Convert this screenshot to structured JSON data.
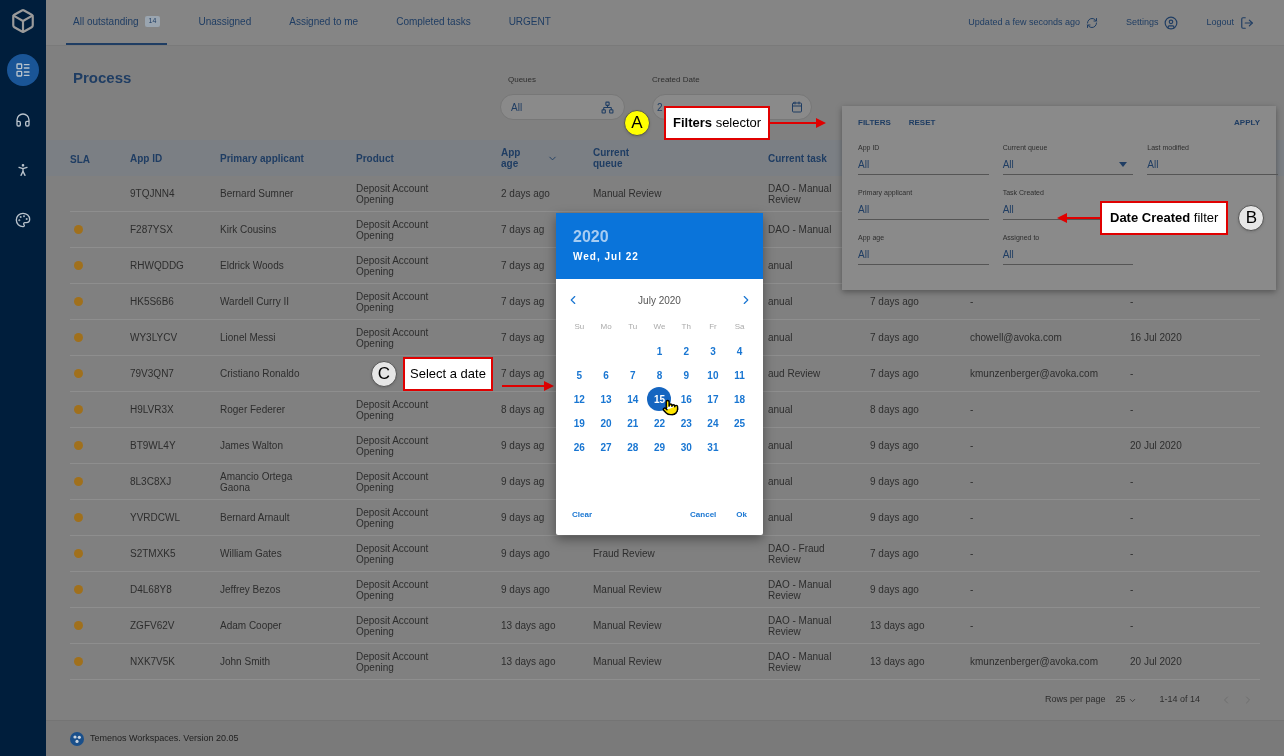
{
  "sidebar": {
    "items": [
      {
        "kind": "dashboard",
        "selected": true
      },
      {
        "kind": "support",
        "selected": false
      },
      {
        "kind": "accessibility",
        "selected": false
      },
      {
        "kind": "palette",
        "selected": false
      }
    ]
  },
  "tabs": [
    {
      "label": "All outstanding",
      "badge": "14",
      "selected": true
    },
    {
      "label": "Unassigned",
      "selected": false
    },
    {
      "label": "Assigned to me",
      "selected": false
    },
    {
      "label": "Completed tasks",
      "selected": false
    },
    {
      "label": "URGENT",
      "selected": false
    }
  ],
  "header_right": {
    "status": "Updated a few seconds ago",
    "settings": "Settings",
    "logout": "Logout"
  },
  "page_title": "Process",
  "filter_bar": {
    "queues": {
      "label": "Queues",
      "value": "All"
    },
    "created_date": {
      "label": "Created Date",
      "value": "2"
    }
  },
  "table": {
    "sla_header": "SLA",
    "columns": [
      {
        "label": "App ID",
        "sorted": false
      },
      {
        "label": "Primary applicant",
        "sorted": false
      },
      {
        "label": "Product",
        "sorted": false
      },
      {
        "label": "App age",
        "sorted": true
      },
      {
        "label": "Current queue",
        "sorted": false
      },
      {
        "label": "Current task",
        "sorted": false
      }
    ],
    "rows": [
      {
        "sla_dot": false,
        "cells": [
          "9TQJNN4",
          "Bernard Sumner",
          "Deposit Account Opening",
          "2 days ago",
          "Manual Review",
          "DAO - Manual Review",
          null,
          null,
          null
        ]
      },
      {
        "sla_dot": true,
        "cells": [
          "F287YSX",
          "Kirk Cousins",
          "Deposit Account Opening",
          "7 days ag",
          null,
          "DAO - Manual",
          null,
          null,
          null
        ]
      },
      {
        "sla_dot": true,
        "cells": [
          "RHWQDDG",
          "Eldrick Woods",
          "Deposit Account Opening",
          "7 days ag",
          null,
          "anual",
          null,
          null,
          null
        ]
      },
      {
        "sla_dot": true,
        "cells": [
          "HK5S6B6",
          "Wardell Curry II",
          "Deposit Account Opening",
          "7 days ag",
          null,
          "anual",
          "7 days ago",
          "-",
          "-"
        ]
      },
      {
        "sla_dot": true,
        "cells": [
          "WY3LYCV",
          "Lionel Messi",
          "Deposit Account Opening",
          "7 days ag",
          null,
          "anual",
          "7 days ago",
          "chowell@avoka.com",
          "16 Jul 2020"
        ]
      },
      {
        "sla_dot": true,
        "cells": [
          "79V3QN7",
          "Cristiano Ronaldo",
          null,
          "7 days ag",
          null,
          "aud Review",
          "7 days ago",
          "kmunzenberger@avoka.com",
          "-"
        ]
      },
      {
        "sla_dot": true,
        "cells": [
          "H9LVR3X",
          "Roger Federer",
          "Deposit Account Opening",
          "8 days ag",
          null,
          "anual",
          "8 days ago",
          "-",
          "-"
        ]
      },
      {
        "sla_dot": true,
        "cells": [
          "BT9WL4Y",
          "James Walton",
          "Deposit Account Opening",
          "9 days ag",
          null,
          "anual",
          "9 days ago",
          "-",
          "20 Jul 2020"
        ]
      },
      {
        "sla_dot": true,
        "cells": [
          "8L3C8XJ",
          "Amancio Ortega Gaona",
          "Deposit Account Opening",
          "9 days ag",
          null,
          "anual",
          "9 days ago",
          "-",
          "-"
        ]
      },
      {
        "sla_dot": true,
        "cells": [
          "YVRDCWL",
          "Bernard Arnault",
          "Deposit Account Opening",
          "9 days ag",
          null,
          "anual",
          "9 days ago",
          "-",
          "-"
        ]
      },
      {
        "sla_dot": true,
        "cells": [
          "S2TMXK5",
          "William Gates",
          "Deposit Account Opening",
          "9 days ago",
          "Fraud Review",
          "DAO - Fraud Review",
          "7 days ago",
          "-",
          "-"
        ]
      },
      {
        "sla_dot": true,
        "cells": [
          "D4L68Y8",
          "Jeffrey Bezos",
          "Deposit Account Opening",
          "9 days ago",
          "Manual Review",
          "DAO - Manual Review",
          "9 days ago",
          "-",
          "-"
        ]
      },
      {
        "sla_dot": true,
        "cells": [
          "ZGFV62V",
          "Adam Cooper",
          "Deposit Account Opening",
          "13 days ago",
          "Manual Review",
          "DAO - Manual Review",
          "13 days ago",
          "-",
          "-"
        ]
      },
      {
        "sla_dot": true,
        "cells": [
          "NXK7V5K",
          "John Smith",
          "Deposit Account Opening",
          "13 days ago",
          "Manual Review",
          "DAO - Manual Review",
          "13 days ago",
          "kmunzenberger@avoka.com",
          "20 Jul 2020"
        ]
      }
    ]
  },
  "filters_panel": {
    "actions": [
      "FILTERS",
      "RESET"
    ],
    "apply": "APPLY",
    "field_rows": [
      [
        {
          "label": "App ID",
          "value": "All",
          "kind": "text"
        },
        {
          "label": "Current queue",
          "value": "All",
          "kind": "select"
        },
        {
          "label": "Last modified",
          "value": "All",
          "kind": "text"
        }
      ],
      [
        {
          "label": "Primary applicant",
          "value": "All",
          "kind": "text"
        },
        {
          "label": "Task Created",
          "value": "All",
          "kind": "text"
        }
      ],
      [
        {
          "label": "App age",
          "value": "All",
          "kind": "text"
        },
        {
          "label": "Assigned to",
          "value": "All",
          "kind": "text"
        }
      ]
    ]
  },
  "date_picker": {
    "year": "2020",
    "date": "Wed, Jul 22",
    "month": "July 2020",
    "weekdays": [
      "Su",
      "Mo",
      "Tu",
      "We",
      "Th",
      "Fr",
      "Sa"
    ],
    "weeks": [
      [
        {
          "label": "1",
          "selected": false
        },
        {
          "label": "2",
          "selected": false
        },
        {
          "label": "3",
          "selected": false
        },
        {
          "label": "4",
          "selected": false
        }
      ],
      [
        {
          "label": "5",
          "selected": false
        },
        {
          "label": "6",
          "selected": false
        },
        {
          "label": "7",
          "selected": false
        },
        {
          "label": "8",
          "selected": false
        },
        {
          "label": "9",
          "selected": false
        },
        {
          "label": "10",
          "selected": false
        },
        {
          "label": "11",
          "selected": false
        }
      ],
      [
        {
          "label": "12",
          "selected": false
        },
        {
          "label": "13",
          "selected": false
        },
        {
          "label": "14",
          "selected": false
        },
        {
          "label": "15",
          "selected": true
        },
        {
          "label": "16",
          "selected": false
        },
        {
          "label": "17",
          "selected": false
        },
        {
          "label": "18",
          "selected": false
        }
      ],
      [
        {
          "label": "19",
          "selected": false
        },
        {
          "label": "20",
          "selected": false
        },
        {
          "label": "21",
          "selected": false
        },
        {
          "label": "22",
          "selected": false
        },
        {
          "label": "23",
          "selected": false
        },
        {
          "label": "24",
          "selected": false
        },
        {
          "label": "25",
          "selected": false
        }
      ],
      [
        {
          "label": "26",
          "selected": false
        },
        {
          "label": "27",
          "selected": false
        },
        {
          "label": "28",
          "selected": false
        },
        {
          "label": "29",
          "selected": false
        },
        {
          "label": "30",
          "selected": false
        },
        {
          "label": "31",
          "selected": false
        }
      ]
    ],
    "buttons": [
      "Clear",
      "Cancel",
      "Ok"
    ]
  },
  "annotations": [
    {
      "letter": "A",
      "text": "**Filters** selector",
      "color": "#ffff00"
    },
    {
      "letter": "B",
      "text": "**Date Created** filter",
      "color": "#e6e6e6"
    },
    {
      "letter": "C",
      "text": "Select a date",
      "color": "#e6e6e6"
    }
  ],
  "pagination": {
    "rows_label": "Rows per page",
    "rows_value": "25",
    "range": "1-14 of 14"
  },
  "footer": {
    "text": "Temenos Workspaces. Version 20.05"
  }
}
